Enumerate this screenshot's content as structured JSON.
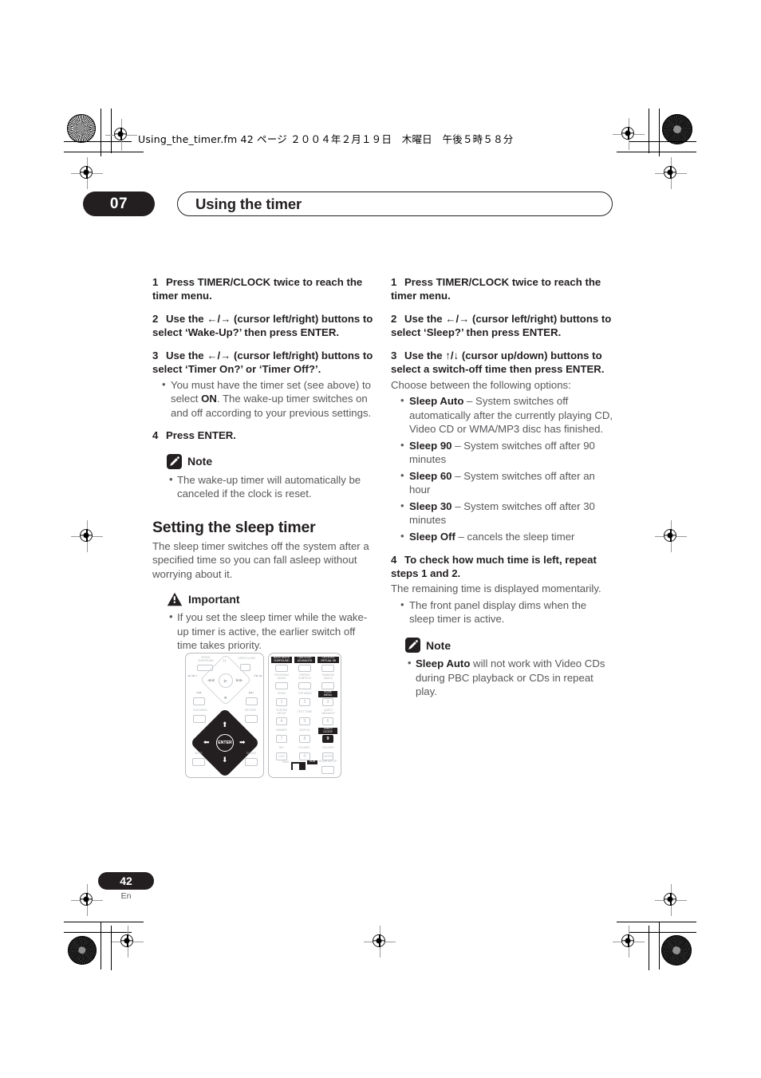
{
  "header": {
    "file_stamp": "Using_the_timer.fm  42 ページ  ２００４年２月１９日　木曜日　午後５時５８分"
  },
  "chapter": {
    "number": "07",
    "title": "Using the timer"
  },
  "left_column": {
    "steps": [
      {
        "n": "1",
        "text": "Press TIMER/CLOCK twice to reach the timer menu."
      },
      {
        "n": "2",
        "text": "Use the ←/→ (cursor left/right) buttons to select ‘Wake-Up?’ then press ENTER."
      },
      {
        "n": "3",
        "text": "Use the ←/→ (cursor left/right) buttons to select ‘Timer On?’ or ‘Timer Off?’."
      }
    ],
    "step3_bullet_a": "You must have the timer set (see above) to select ",
    "step3_bullet_bold": "ON",
    "step3_bullet_b": ". The wake-up timer switches on and off according to your previous settings.",
    "step4": {
      "n": "4",
      "text": "Press ENTER."
    },
    "note": {
      "label": "Note",
      "icon": "pencil-icon",
      "bullets": [
        "The wake-up timer will automatically be canceled if the clock is reset."
      ]
    },
    "section_heading": "Setting the sleep timer",
    "section_intro": "The sleep timer switches off the system after a specified time so you can fall asleep without worrying about it.",
    "important": {
      "label": "Important",
      "icon": "warning-triangle-icon",
      "bullets": [
        "If you set the sleep timer while the wake-up timer is active, the earlier switch off time takes priority."
      ]
    }
  },
  "right_column": {
    "steps": [
      {
        "n": "1",
        "text": "Press TIMER/CLOCK twice to reach the timer menu."
      },
      {
        "n": "2",
        "text": "Use the ←/→ (cursor left/right) buttons to select ‘Sleep?’ then press ENTER."
      },
      {
        "n": "3",
        "text": "Use the ↑/↓ (cursor up/down) buttons to select a switch-off time then press ENTER."
      }
    ],
    "options_intro": "Choose between the following options:",
    "options": [
      {
        "term": "Sleep Auto",
        "desc": " – System switches off automatically after the currently playing CD, Video CD or WMA/MP3 disc has finished."
      },
      {
        "term": "Sleep 90",
        "desc": " – System switches off after 90 minutes"
      },
      {
        "term": "Sleep 60",
        "desc": " – System switches off after an hour"
      },
      {
        "term": "Sleep 30",
        "desc": " – System switches off after 30 minutes"
      },
      {
        "term": "Sleep Off",
        "desc": " – cancels the sleep timer"
      }
    ],
    "step4": {
      "n": "4",
      "text": "To check how much time is left, repeat steps 1 and 2."
    },
    "step4_sub": "The remaining time is displayed momentarily.",
    "step4_bullet": "The front panel display dims when the sleep timer is active.",
    "note": {
      "label": "Note",
      "icon": "pencil-icon",
      "bullet_bold": "Sleep Auto",
      "bullet_rest": " will not work with Video CDs during PBC playback or CDs in repeat play."
    }
  },
  "remote": {
    "left_labels": {
      "front_surround": "FRONT\nSURROUND",
      "open_close": "OPEN CLOSE",
      "dvd_menu": "DVD MENU",
      "return": "RETURN",
      "mute": "MUTE",
      "sound": "SOUND",
      "enter": "ENTER",
      "prev_track": "|◀◀",
      "next_track": "▶▶|",
      "rev_scan": "◀◀",
      "fwd_scan": "▶▶",
      "play": "▶",
      "pause": "II",
      "stop": "■",
      "left_small": "◀1/◀10",
      "right_small": "10▶/1▶"
    },
    "keypad": [
      {
        "label": "BASS MODE\nSURROUND",
        "key": "",
        "highlight_label": true
      },
      {
        "label": "DIALOGUE\nADVANCED",
        "key": "",
        "highlight_label": true
      },
      {
        "label": "CH LEVEL\nVIRTUAL SB",
        "key": "",
        "highlight_label": true
      },
      {
        "label": "PROGRAM\nAUDIO",
        "key": ""
      },
      {
        "label": "REPEAT\nSUBTITLE",
        "key": ""
      },
      {
        "label": "RANDOM\nANGLE",
        "key": ""
      },
      {
        "label": "ZOOM",
        "key": "1"
      },
      {
        "label": "TOP MENU",
        "key": "2"
      },
      {
        "label": "HOME\nMENU",
        "key": "3",
        "highlight_label": true
      },
      {
        "label": "SYSTEM\nSETUP",
        "key": "4"
      },
      {
        "label": "TEST TONE",
        "key": "5"
      },
      {
        "label": "QUIET/\nMIDNIGHT",
        "key": "6"
      },
      {
        "label": "DIMMER",
        "key": "7"
      },
      {
        "label": "DISPLAY",
        "key": "8"
      },
      {
        "label": "TIMER/\nCLOCK",
        "key": "9",
        "key_on": true,
        "highlight_label": true
      },
      {
        "label": "SR+",
        "key": "CLR"
      },
      {
        "label": "FOLDER–",
        "key": "0"
      },
      {
        "label": "FOLDER+",
        "key": "ENTER"
      }
    ],
    "main_label": "MAIN",
    "sub_label": "SUB",
    "room_setup": "ROOM SETUP"
  },
  "footer": {
    "page_number": "42",
    "language": "En"
  }
}
